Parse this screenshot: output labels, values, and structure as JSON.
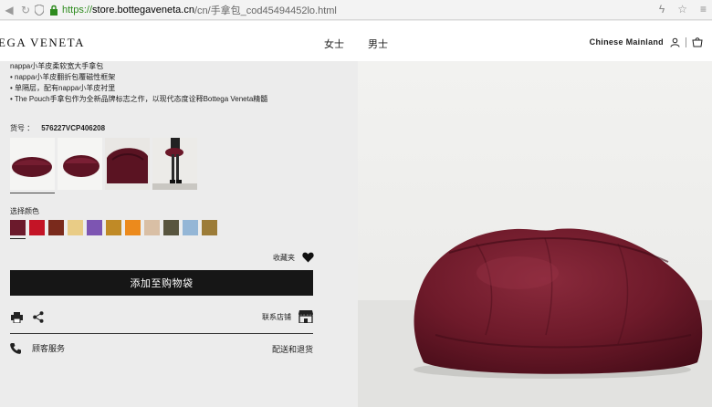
{
  "browser": {
    "url_scheme": "https://",
    "url_host": "store.bottegaveneta.cn",
    "url_path": "/cn/手拿包_cod45494452lo.html"
  },
  "header": {
    "brand": "EGA VENETA",
    "nav": [
      "女士",
      "男士"
    ],
    "region": "Chinese Mainland"
  },
  "product": {
    "description": [
      "nappa小羊皮柔软宽大手拿包",
      "• nappa小羊皮翻折包覆磁性框架",
      "• 单隔层，配有nappa小羊皮衬里",
      "• The Pouch手拿包作为全新品牌标志之作，以现代态度诠释Bottega Veneta精髓"
    ],
    "sku_label": "货号 ：",
    "sku_value": "576227VCP406208",
    "color_label": "选择颜色",
    "swatches": [
      "#6b1a2c",
      "#c41426",
      "#7a2a1c",
      "#e9cc86",
      "#7d55b2",
      "#c08a26",
      "#ec8a1c",
      "#d9bfa5",
      "#58553f",
      "#94b6d6",
      "#9c7c38"
    ],
    "selected_swatch": 0,
    "favorite_label": "收藏夹",
    "add_to_bag": "添加至购物袋",
    "store_label": "联系店铺",
    "service_label": "顾客服务",
    "shipping_label": "配送和退货"
  },
  "colors": {
    "bag": "#6e1a2a",
    "button": "#161616"
  }
}
